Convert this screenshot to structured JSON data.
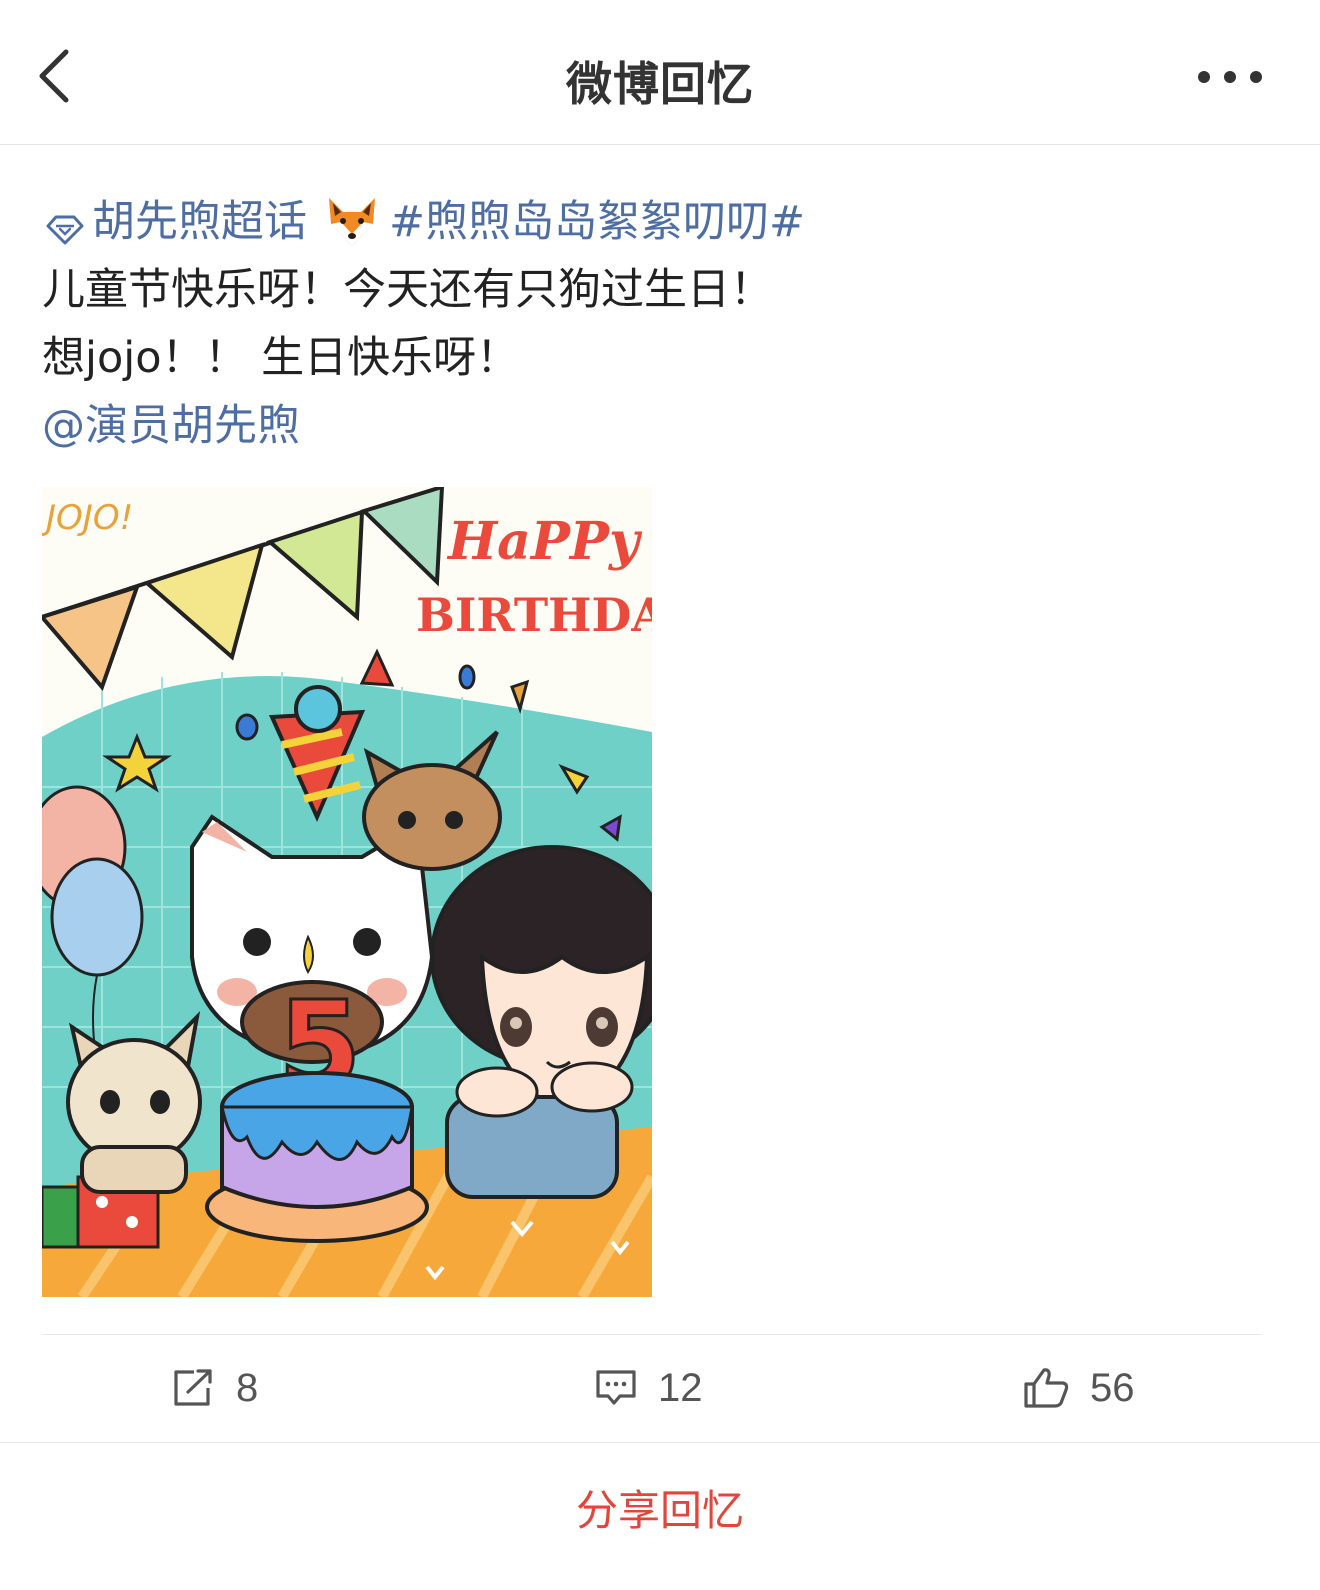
{
  "header": {
    "title": "微博回忆",
    "back_icon": "chevron-left-icon",
    "more_icon": "more-horizontal-icon"
  },
  "post": {
    "supertopic": "胡先煦超话",
    "supertopic_icon": "diamond-icon",
    "emoji_icon": "fox-face-icon",
    "hashtag": "#煦煦岛岛絮絮叨叨#",
    "line1": "儿童节快乐呀！今天还有只狗过生日！",
    "line2": "想jojo！！ 生日快乐呀！",
    "mention": "@演员胡先煦",
    "image": {
      "corner_text": "JOJO!",
      "happy": "HaPPy",
      "birthday": "BIRTHDAY!",
      "candle_number": "5"
    }
  },
  "actions": {
    "repost_count": "8",
    "comment_count": "12",
    "like_count": "56"
  },
  "footer": {
    "share_label": "分享回忆"
  },
  "colors": {
    "link": "#4e6ea3",
    "share": "#e0473a",
    "title": "#333333"
  }
}
